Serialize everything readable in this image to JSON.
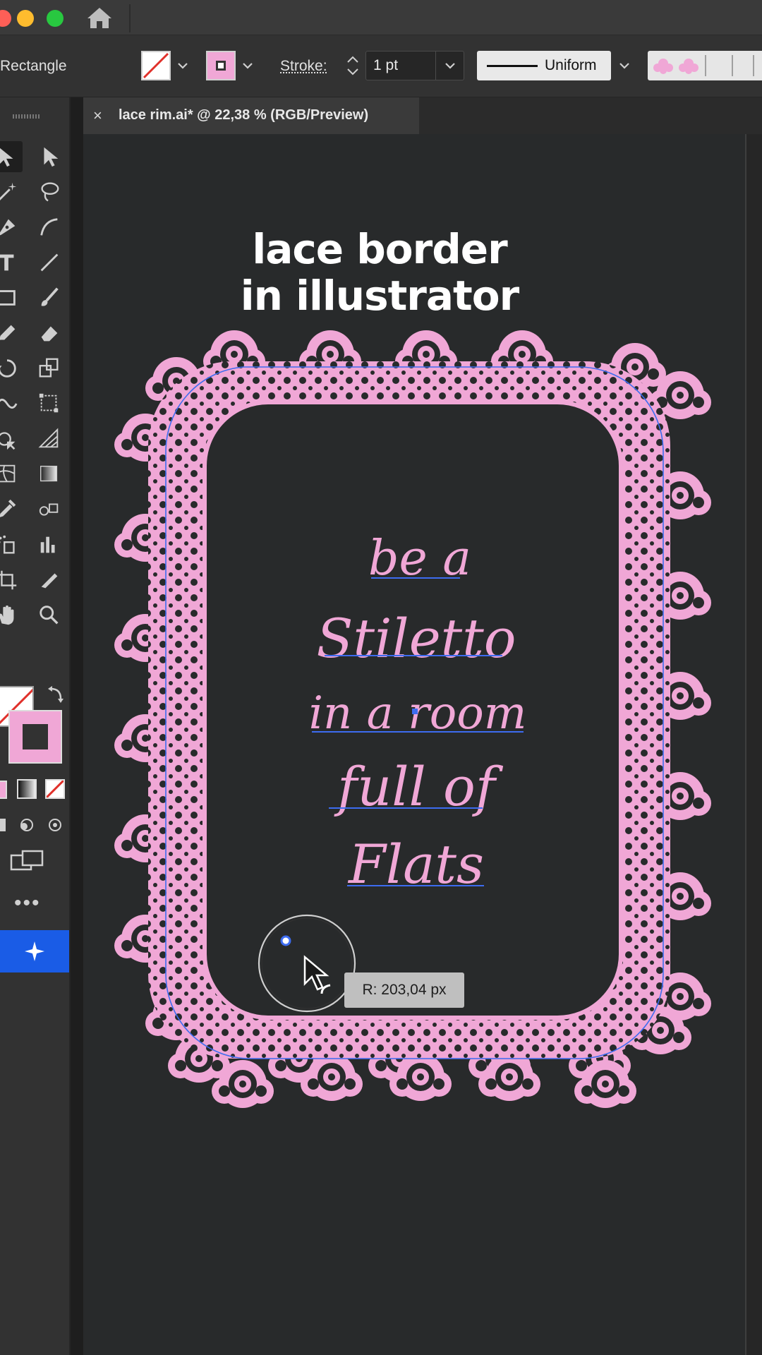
{
  "toolbar": {
    "tool_name": "Rectangle",
    "stroke_label": "Stroke:",
    "stroke_weight": "1 pt",
    "profile_label": "Uniform"
  },
  "document": {
    "tab_close": "×",
    "tab_title": "lace rim.ai* @ 22,38 % (RGB/Preview)"
  },
  "artwork": {
    "title_line1": "lace border",
    "title_line2": "in illustrator",
    "quote_lines": [
      "be a",
      "Stiletto",
      "in a room",
      "full of",
      "Flats"
    ]
  },
  "cursor_readout": "R: 203,04 px",
  "colors": {
    "lace": "#f0a7d6",
    "selection": "#3d6cf0",
    "canvas": "#282a2b",
    "ai_button": "#1a5ce6"
  },
  "icons": [
    "home-icon",
    "selection-tool-icon",
    "direct-selection-tool-icon",
    "magic-wand-tool-icon",
    "lasso-tool-icon",
    "pen-tool-icon",
    "curvature-tool-icon",
    "type-tool-icon",
    "line-segment-tool-icon",
    "rectangle-tool-icon",
    "paintbrush-tool-icon",
    "pencil-tool-icon",
    "eraser-tool-icon",
    "rotate-tool-icon",
    "scale-tool-icon",
    "warp-tool-icon",
    "free-transform-tool-icon",
    "shape-builder-tool-icon",
    "perspective-grid-tool-icon",
    "mesh-tool-icon",
    "gradient-tool-icon",
    "eyedropper-tool-icon",
    "blend-tool-icon",
    "symbol-sprayer-tool-icon",
    "column-graph-tool-icon",
    "artboard-tool-icon",
    "slice-tool-icon",
    "hand-tool-icon",
    "zoom-tool-icon",
    "swap-fill-stroke-icon",
    "more-tools-icon",
    "generative-ai-icon"
  ]
}
